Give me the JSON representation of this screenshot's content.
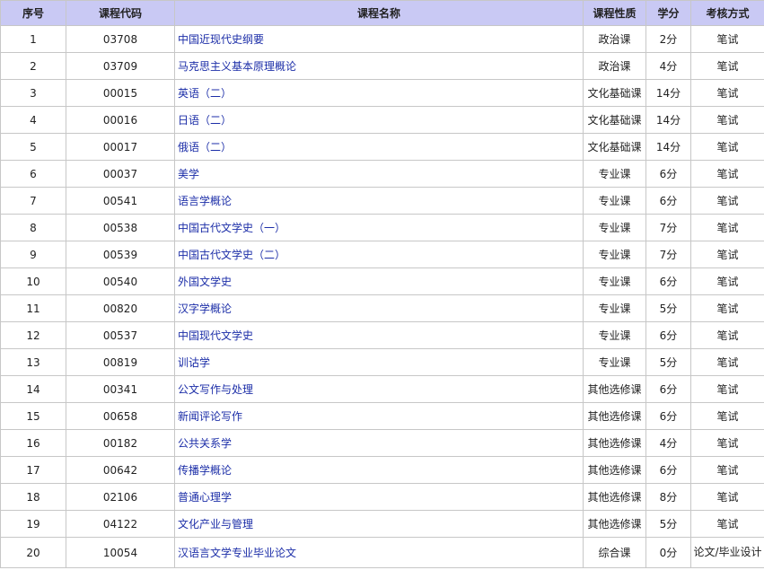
{
  "table": {
    "headers": [
      "序号",
      "课程代码",
      "课程名称",
      "课程性质",
      "学分",
      "考核方式"
    ],
    "rows": [
      {
        "no": "1",
        "code": "03708",
        "name": "中国近现代史纲要",
        "type": "政治课",
        "credit": "2分",
        "exam": "笔试"
      },
      {
        "no": "2",
        "code": "03709",
        "name": "马克思主义基本原理概论",
        "type": "政治课",
        "credit": "4分",
        "exam": "笔试"
      },
      {
        "no": "3",
        "code": "00015",
        "name": "英语（二）",
        "type": "文化基础课",
        "credit": "14分",
        "exam": "笔试"
      },
      {
        "no": "4",
        "code": "00016",
        "name": "日语（二）",
        "type": "文化基础课",
        "credit": "14分",
        "exam": "笔试"
      },
      {
        "no": "5",
        "code": "00017",
        "name": "俄语（二）",
        "type": "文化基础课",
        "credit": "14分",
        "exam": "笔试"
      },
      {
        "no": "6",
        "code": "00037",
        "name": "美学",
        "type": "专业课",
        "credit": "6分",
        "exam": "笔试"
      },
      {
        "no": "7",
        "code": "00541",
        "name": "语言学概论",
        "type": "专业课",
        "credit": "6分",
        "exam": "笔试"
      },
      {
        "no": "8",
        "code": "00538",
        "name": "中国古代文学史（一）",
        "type": "专业课",
        "credit": "7分",
        "exam": "笔试"
      },
      {
        "no": "9",
        "code": "00539",
        "name": "中国古代文学史（二）",
        "type": "专业课",
        "credit": "7分",
        "exam": "笔试"
      },
      {
        "no": "10",
        "code": "00540",
        "name": "外国文学史",
        "type": "专业课",
        "credit": "6分",
        "exam": "笔试"
      },
      {
        "no": "11",
        "code": "00820",
        "name": "汉字学概论",
        "type": "专业课",
        "credit": "5分",
        "exam": "笔试"
      },
      {
        "no": "12",
        "code": "00537",
        "name": "中国现代文学史",
        "type": "专业课",
        "credit": "6分",
        "exam": "笔试"
      },
      {
        "no": "13",
        "code": "00819",
        "name": "训诂学",
        "type": "专业课",
        "credit": "5分",
        "exam": "笔试"
      },
      {
        "no": "14",
        "code": "00341",
        "name": "公文写作与处理",
        "type": "其他选修课",
        "credit": "6分",
        "exam": "笔试"
      },
      {
        "no": "15",
        "code": "00658",
        "name": "新闻评论写作",
        "type": "其他选修课",
        "credit": "6分",
        "exam": "笔试"
      },
      {
        "no": "16",
        "code": "00182",
        "name": "公共关系学",
        "type": "其他选修课",
        "credit": "4分",
        "exam": "笔试"
      },
      {
        "no": "17",
        "code": "00642",
        "name": "传播学概论",
        "type": "其他选修课",
        "credit": "6分",
        "exam": "笔试"
      },
      {
        "no": "18",
        "code": "02106",
        "name": "普通心理学",
        "type": "其他选修课",
        "credit": "8分",
        "exam": "笔试"
      },
      {
        "no": "19",
        "code": "04122",
        "name": "文化产业与管理",
        "type": "其他选修课",
        "credit": "5分",
        "exam": "笔试"
      },
      {
        "no": "20",
        "code": "10054",
        "name": "汉语言文学专业毕业论文",
        "type": "综合课",
        "credit": "0分",
        "exam": "论文/毕业设计"
      }
    ]
  },
  "colors": {
    "header_bg": "#c9c9f4",
    "link": "#1c2ea8",
    "border": "#c7c7c7"
  }
}
